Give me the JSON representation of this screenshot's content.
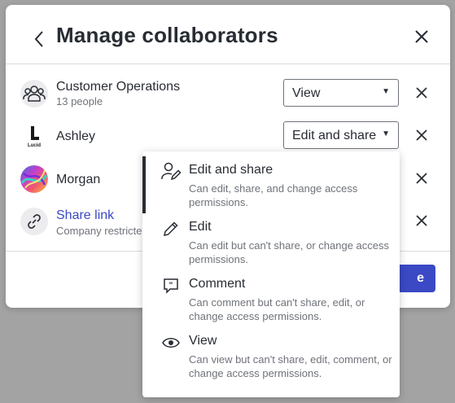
{
  "dialog": {
    "title": "Manage collaborators",
    "back_icon": "chevron-left-icon",
    "close_icon": "close-icon"
  },
  "collaborators": [
    {
      "name": "Customer Operations",
      "subtitle": "13 people",
      "avatar_icon": "group-icon",
      "permission": "View"
    },
    {
      "name": "Ashley",
      "avatar_icon": "lucid-logo-icon",
      "avatar_text": "Lucid",
      "permission": "Edit and share"
    },
    {
      "name": "Morgan",
      "avatar_icon": "avatar-image"
    },
    {
      "name": "Share link",
      "subtitle": "Company restricted",
      "avatar_icon": "link-icon"
    }
  ],
  "footer": {
    "primary_button_visible_text": "e"
  },
  "permission_menu": {
    "selected": "Edit and share",
    "items": [
      {
        "title": "Edit and share",
        "description": "Can edit, share, and change access permissions.",
        "icon": "user-edit-icon"
      },
      {
        "title": "Edit",
        "description": "Can edit but can't share, or change access permissions.",
        "icon": "pencil-icon"
      },
      {
        "title": "Comment",
        "description": "Can comment but can't share, edit, or change access permissions.",
        "icon": "comment-icon"
      },
      {
        "title": "View",
        "description": "Can view but can't share, edit, comment, or change access permissions.",
        "icon": "eye-icon"
      }
    ]
  },
  "colors": {
    "accent": "#3b49c4",
    "text": "#282c33",
    "muted": "#6f737a",
    "overlay": "#a3a3a3"
  }
}
